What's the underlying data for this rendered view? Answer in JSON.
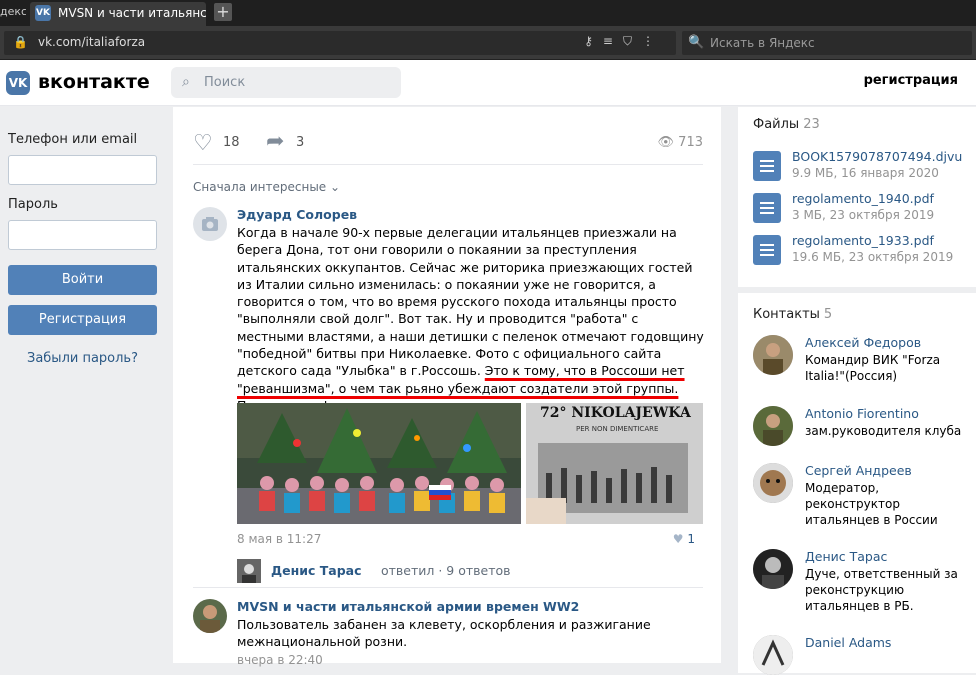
{
  "browser": {
    "prev_tab_label": "декс",
    "active_tab_title": "MVSN и части итальянско",
    "new_tab": "+",
    "url": "vk.com/italiaforza",
    "search_placeholder": "Искать в Яндекс"
  },
  "vk": {
    "brand": "вконтакте",
    "search_placeholder": "Поиск",
    "register_link": "регистрация"
  },
  "login": {
    "phone_label": "Телефон или email",
    "password_label": "Пароль",
    "login_button": "Войти",
    "register_button": "Регистрация",
    "forgot_link": "Забыли пароль?"
  },
  "post": {
    "likes": "18",
    "shares": "3",
    "views": "713",
    "sort_label": "Сначала интересные"
  },
  "comment1": {
    "author": "Эдуард Солорев",
    "text_plain": "Когда в начале 90-х первые делегации итальянцев приезжали на берега Дона, тот они говорили о покаянии за преступления итальянских оккупантов. Сейчас же риторика приезжающих гостей из Италии сильно изменилась: о покаянии уже не говорится, а говорится о том, что во время русского похода итальянцы просто \"выполняли свой долг\". Вот так. Ну и проводится \"работа\" с местными властями, а наши детишки с пеленок отмечают годовщину \"победной\" битвы при Николаевке. Фото с официального сайта детского сада \"Улыбка\" в г.Россошь.",
    "text_underlined": "Это к тому, что в Россоши нет \"реваншизма\", о чем так рьяно убеждают создатели этой группы. Посмотрите фактам в лицо.",
    "photo2_header": "72° NIKOLAJEWKA",
    "photo2_sub": "PER NON DIMENTICARE",
    "date": "8 мая в 11:27",
    "likes": "1"
  },
  "reply": {
    "author": "Денис Тарас",
    "meta": "ответил · 9 ответов"
  },
  "comment2": {
    "author": "MVSN и части итальянской армии времен WW2",
    "text": "Пользователь забанен за клевету, оскорбления и разжигание межнациональной розни.",
    "date": "вчера в 22:40"
  },
  "files": {
    "title": "Файлы",
    "count": "23",
    "items": [
      {
        "name": "BOOK1579078707494.djvu",
        "meta": "9.9 МБ, 16 января 2020"
      },
      {
        "name": "regolamento_1940.pdf",
        "meta": "3 МБ, 23 октября 2019"
      },
      {
        "name": "regolamento_1933.pdf",
        "meta": "19.6 МБ, 23 октября 2019"
      }
    ]
  },
  "contacts": {
    "title": "Контакты",
    "count": "5",
    "items": [
      {
        "name": "Алексей Федоров",
        "role": "Командир ВИК \"Forza Italia!\"(Россия)"
      },
      {
        "name": "Antonio Fiorentino",
        "role": "зам.руководителя клуба"
      },
      {
        "name": "Сергей Андреев",
        "role": "Модератор, реконструктор итальянцев в России"
      },
      {
        "name": "Денис Тарас",
        "role": "Дуче, ответственный за реконструкцию итальянцев в РБ."
      },
      {
        "name": "Daniel Adams",
        "role": ""
      }
    ]
  },
  "colors": {
    "vk_blue": "#4a76a8",
    "link": "#2a5885",
    "button": "#5181b8",
    "underline": "#e00000"
  }
}
